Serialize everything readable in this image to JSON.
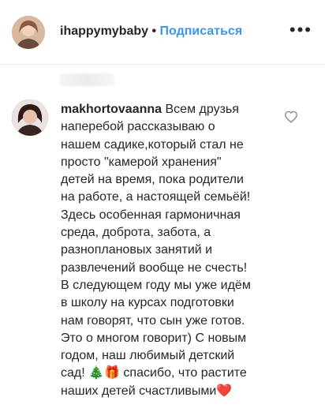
{
  "post_header": {
    "username": "ihappymybaby",
    "separator": "•",
    "follow_label": "Подписаться",
    "more_label": "•••"
  },
  "comment": {
    "username": "makhortovaanna",
    "text": "Всем друзья\nнаперебой рассказываю о\nнашем садике,который стал не\nпросто \"камерой хранения\"\nдетей на время, пока родители\nна работе, а настоящей семьёй!\nЗдесь особенная гармоничная\nсреда, доброта, забота, а\nразноплановых занятий и\nразвлечений вообще не счесть!\nВ следующем году мы уже идём\nв школу на курсах подготовки\nнам говорят, что сын уже готов.\nЭто о многом говорит) С новым\nгодом, наш любимый детский\nсад! 🎄🎁 спасибо, что растите\nнаших детей счастливыми❤️"
  },
  "colors": {
    "accent": "#3897f0",
    "text": "#262626",
    "icon": "#8e8e8e"
  },
  "icons": {
    "like": "heart-outline-icon",
    "more": "three-dots-icon"
  }
}
